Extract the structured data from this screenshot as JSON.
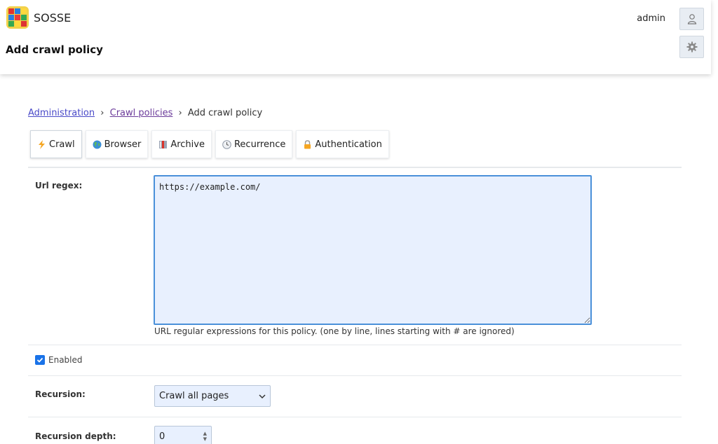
{
  "app": {
    "name": "SOSSE"
  },
  "header": {
    "page_title": "Add crawl policy",
    "user": "admin"
  },
  "breadcrumb": {
    "items": [
      "Administration",
      "Crawl policies"
    ],
    "current": "Add crawl policy",
    "separator": "›"
  },
  "tabs": [
    {
      "label": "Crawl",
      "icon": "lightning-icon"
    },
    {
      "label": "Browser",
      "icon": "globe-icon"
    },
    {
      "label": "Archive",
      "icon": "archive-book-icon"
    },
    {
      "label": "Recurrence",
      "icon": "clock-icon"
    },
    {
      "label": "Authentication",
      "icon": "lock-icon"
    }
  ],
  "form": {
    "url_regex": {
      "label": "Url regex:",
      "value": "https://example.com/",
      "help": "URL regular expressions for this policy. (one by line, lines starting with # are ignored)"
    },
    "enabled": {
      "label": "Enabled",
      "checked": true
    },
    "recursion": {
      "label": "Recursion:",
      "value": "Crawl all pages"
    },
    "recursion_depth": {
      "label": "Recursion depth:",
      "value": "0"
    }
  },
  "colors": {
    "accent": "#1a73e8",
    "input_bg": "#e8f0fe",
    "link": "#4a4ac8"
  }
}
